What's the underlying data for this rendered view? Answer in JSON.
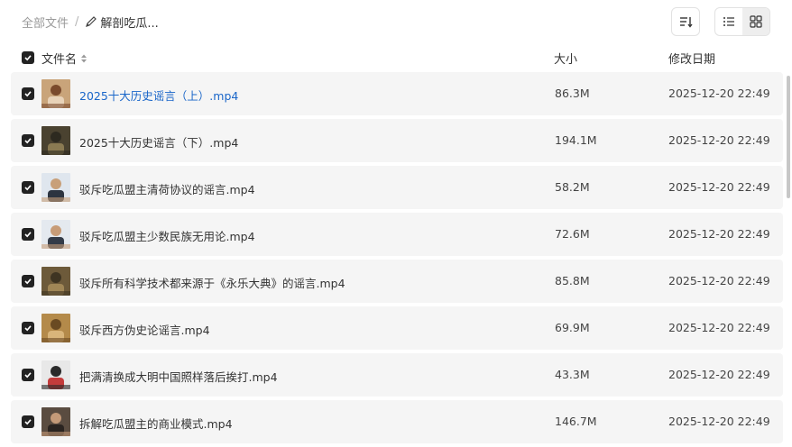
{
  "breadcrumb": {
    "root": "全部文件",
    "separator": "/",
    "folder": "解剖吃瓜..."
  },
  "toolbar": {
    "sort_icon": "sort-lines-icon",
    "view_list_icon": "list-view-icon",
    "view_grid_icon": "grid-view-icon",
    "active_view": "list"
  },
  "table": {
    "headers": {
      "name": "文件名",
      "size": "大小",
      "modified": "修改日期"
    },
    "select_all_checked": true,
    "rows": [
      {
        "name": "2025十大历史谣言（上）.mp4",
        "size": "86.3M",
        "modified": "2025-12-20 22:49",
        "checked": true,
        "highlighted": true
      },
      {
        "name": "2025十大历史谣言（下）.mp4",
        "size": "194.1M",
        "modified": "2025-12-20 22:49",
        "checked": true
      },
      {
        "name": "驳斥吃瓜盟主清荷协议的谣言.mp4",
        "size": "58.2M",
        "modified": "2025-12-20 22:49",
        "checked": true
      },
      {
        "name": "驳斥吃瓜盟主少数民族无用论.mp4",
        "size": "72.6M",
        "modified": "2025-12-20 22:49",
        "checked": true
      },
      {
        "name": "驳斥所有科学技术都来源于《永乐大典》的谣言.mp4",
        "size": "85.8M",
        "modified": "2025-12-20 22:49",
        "checked": true
      },
      {
        "name": "驳斥西方伪史论谣言.mp4",
        "size": "69.9M",
        "modified": "2025-12-20 22:49",
        "checked": true
      },
      {
        "name": "把满清换成大明中国照样落后挨打.mp4",
        "size": "43.3M",
        "modified": "2025-12-20 22:49",
        "checked": true
      },
      {
        "name": "拆解吃瓜盟主的商业模式.mp4",
        "size": "146.7M",
        "modified": "2025-12-20 22:49",
        "checked": true
      }
    ]
  },
  "colors": {
    "link": "#1a66c9",
    "row_bg": "#f5f5f5",
    "checkbox": "#222222"
  }
}
